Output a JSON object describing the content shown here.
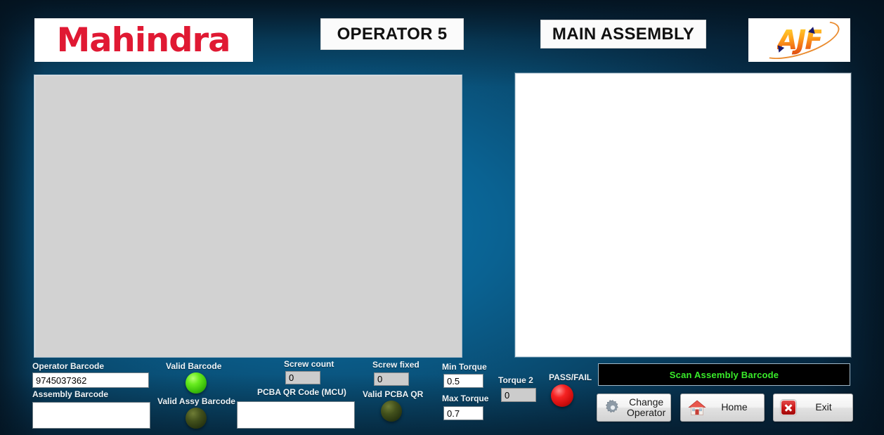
{
  "header": {
    "brand_logo": "mahindra-logo",
    "brand_text": "Mahindra",
    "operator_title": "OPERATOR 5",
    "station_title": "MAIN ASSEMBLY",
    "vendor_logo": "ajf-logo",
    "vendor_text": "AJF"
  },
  "panels": {
    "camera_panel_name": "camera-preview",
    "result_panel_name": "result-display"
  },
  "fields": {
    "operator_barcode": {
      "label": "Operator Barcode",
      "value": "9745037362",
      "readonly": false
    },
    "assembly_barcode": {
      "label": "Assembly Barcode",
      "value": "",
      "readonly": false
    },
    "pcba_qr_code": {
      "label": "PCBA QR Code (MCU)",
      "value": "",
      "readonly": false
    },
    "screw_count": {
      "label": "Screw count",
      "value": "0",
      "readonly": true
    },
    "screw_fixed": {
      "label": "Screw fixed",
      "value": "0",
      "readonly": true
    },
    "min_torque": {
      "label": "Min Torque",
      "value": "0.5",
      "readonly": false
    },
    "max_torque": {
      "label": "Max Torque",
      "value": "0.7",
      "readonly": false
    },
    "torque_2": {
      "label": "Torque 2",
      "value": "0",
      "readonly": true
    }
  },
  "indicators": {
    "valid_barcode": {
      "label": "Valid Barcode",
      "state": "on",
      "color": "#68ec1f"
    },
    "valid_assy_barcode": {
      "label": "Valid Assy Barcode",
      "state": "off",
      "color": "#43511c"
    },
    "valid_pcba_qr": {
      "label": "Valid PCBA QR",
      "state": "off",
      "color": "#43511c"
    },
    "pass_fail": {
      "label": "PASS/FAIL",
      "state": "fail",
      "color": "#f52222"
    }
  },
  "status": {
    "message": "Scan Assembly Barcode",
    "text_color": "#39ec2a",
    "background_color": "#000000"
  },
  "buttons": {
    "change_operator": "Change Operator",
    "change_operator_line1": "Change",
    "change_operator_line2": "Operator",
    "home": "Home",
    "exit": "Exit"
  }
}
